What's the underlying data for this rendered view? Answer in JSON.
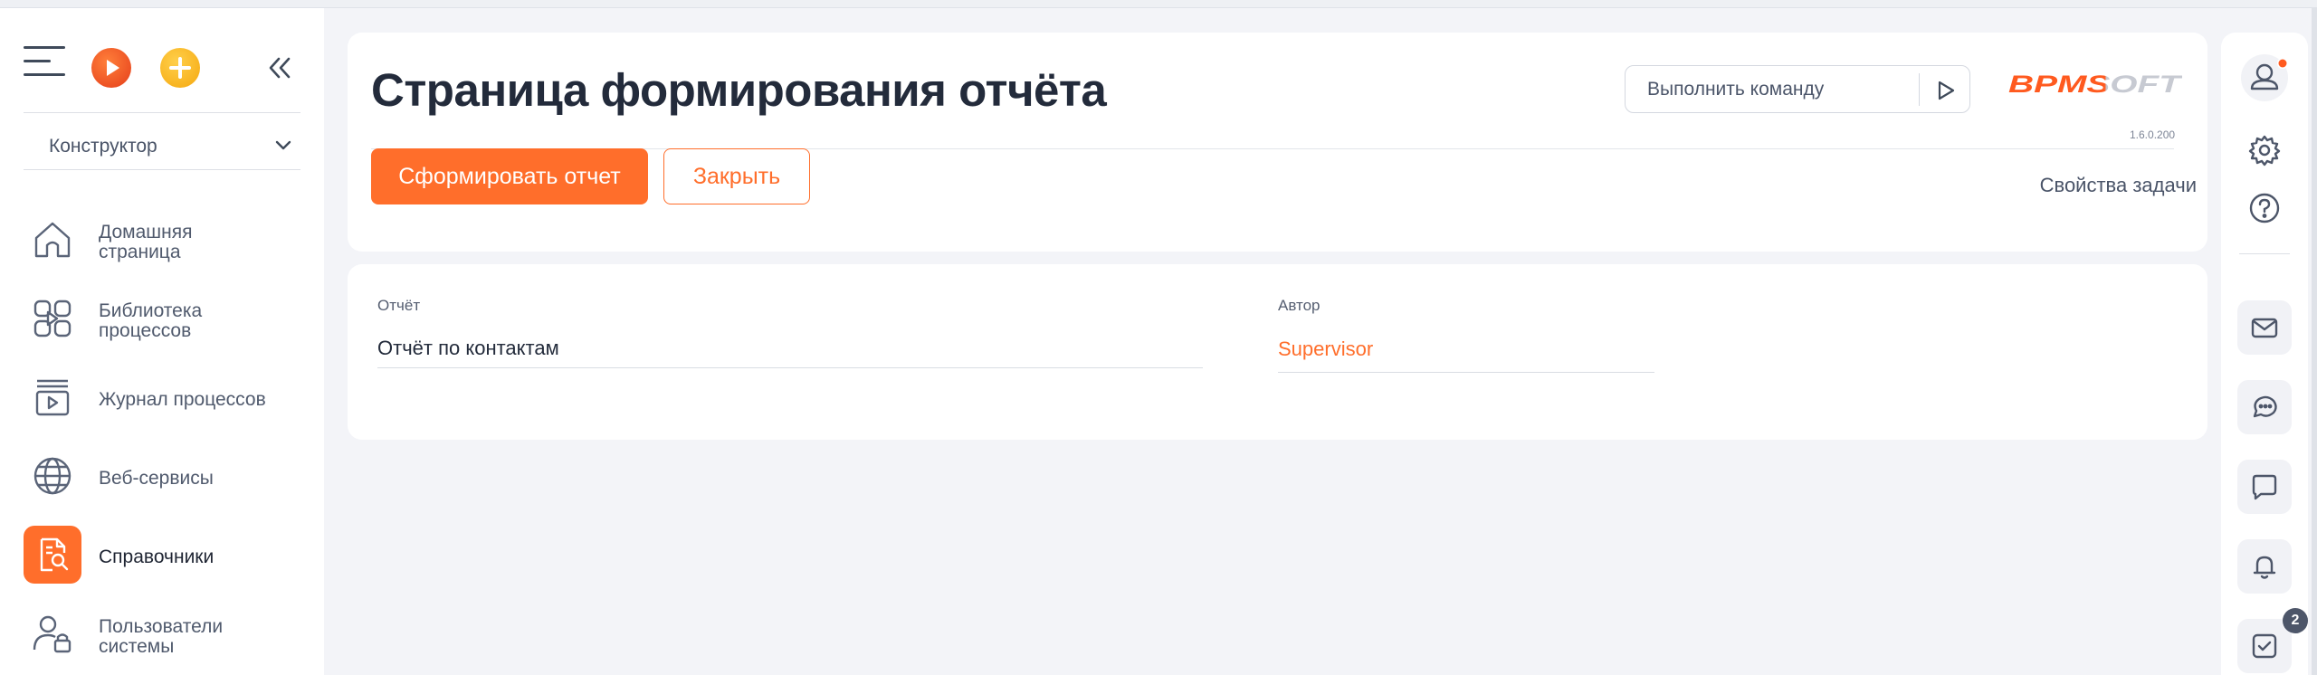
{
  "sidebar": {
    "section_select": "Конструктор",
    "items": [
      {
        "label_1": "Домашняя",
        "label_2": "страница",
        "icon": "home-icon"
      },
      {
        "label_1": "Библиотека",
        "label_2": "процессов",
        "icon": "process-library-icon"
      },
      {
        "label": "Журнал процессов",
        "icon": "process-log-icon"
      },
      {
        "label": "Веб-сервисы",
        "icon": "globe-icon"
      },
      {
        "label": "Справочники",
        "icon": "lookup-search-icon",
        "active": true
      },
      {
        "label_1": "Пользователи",
        "label_2": "системы",
        "icon": "user-lock-icon"
      }
    ]
  },
  "header": {
    "title": "Страница формирования отчёта",
    "command_placeholder": "Выполнить команду",
    "logo_text": "BPMSOFT",
    "version": "1.6.0.200",
    "generate_button": "Сформировать отчет",
    "close_button": "Закрыть",
    "task_properties": "Свойства задачи"
  },
  "fields": {
    "report_label": "Отчёт",
    "report_value": "Отчёт по контактам",
    "author_label": "Автор",
    "author_value": "Supervisor"
  },
  "rail": {
    "tasks_badge": "2"
  },
  "colors": {
    "accent": "#ff6e2b",
    "text": "#232b3b",
    "muted": "#505a6d"
  }
}
